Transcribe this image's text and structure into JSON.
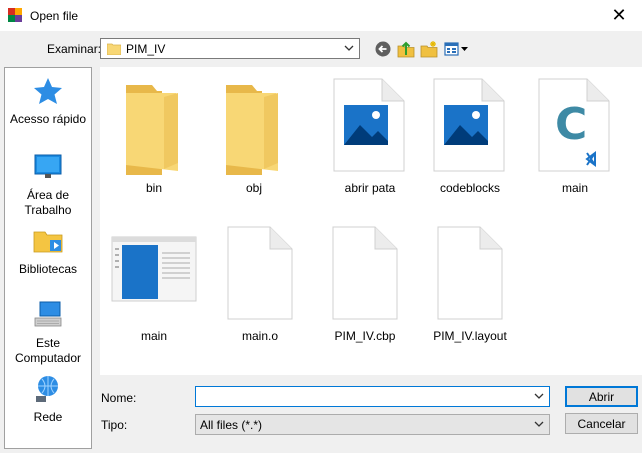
{
  "window": {
    "title": "Open file",
    "close_glyph": "✕"
  },
  "look_in": {
    "label": "Examinar:",
    "value": "PIM_IV"
  },
  "toolbar": {
    "icons": [
      "back-icon",
      "up-folder-icon",
      "new-folder-icon",
      "view-menu-icon"
    ]
  },
  "places": [
    {
      "id": "quick-access",
      "icon": "star-icon",
      "label": "Acesso rápido"
    },
    {
      "id": "desktop",
      "icon": "desktop-icon",
      "label": "Área de Trabalho"
    },
    {
      "id": "libraries",
      "icon": "libraries-icon",
      "label": "Bibliotecas"
    },
    {
      "id": "this-pc",
      "icon": "computer-icon",
      "label": "Este Computador"
    },
    {
      "id": "network",
      "icon": "network-icon",
      "label": "Rede"
    }
  ],
  "files": [
    {
      "name": "bin",
      "kind": "folder"
    },
    {
      "name": "obj",
      "kind": "folder"
    },
    {
      "name": "abrir pata",
      "kind": "image"
    },
    {
      "name": "codeblocks",
      "kind": "image"
    },
    {
      "name": "main",
      "kind": "c-source"
    },
    {
      "name": "main",
      "kind": "executable"
    },
    {
      "name": "main.o",
      "kind": "generic-file"
    },
    {
      "name": "PIM_IV.cbp",
      "kind": "generic-file"
    },
    {
      "name": "PIM_IV.layout",
      "kind": "generic-file"
    }
  ],
  "filename": {
    "label": "Nome:",
    "value": ""
  },
  "filetype": {
    "label": "Tipo:",
    "value": "All files (*.*)"
  },
  "buttons": {
    "open": "Abrir",
    "cancel": "Cancelar"
  },
  "colors": {
    "accent": "#0078d7",
    "folder": "#f8d775",
    "image_tile": "#1a73c8",
    "c_icon": "#3e8aa5"
  }
}
